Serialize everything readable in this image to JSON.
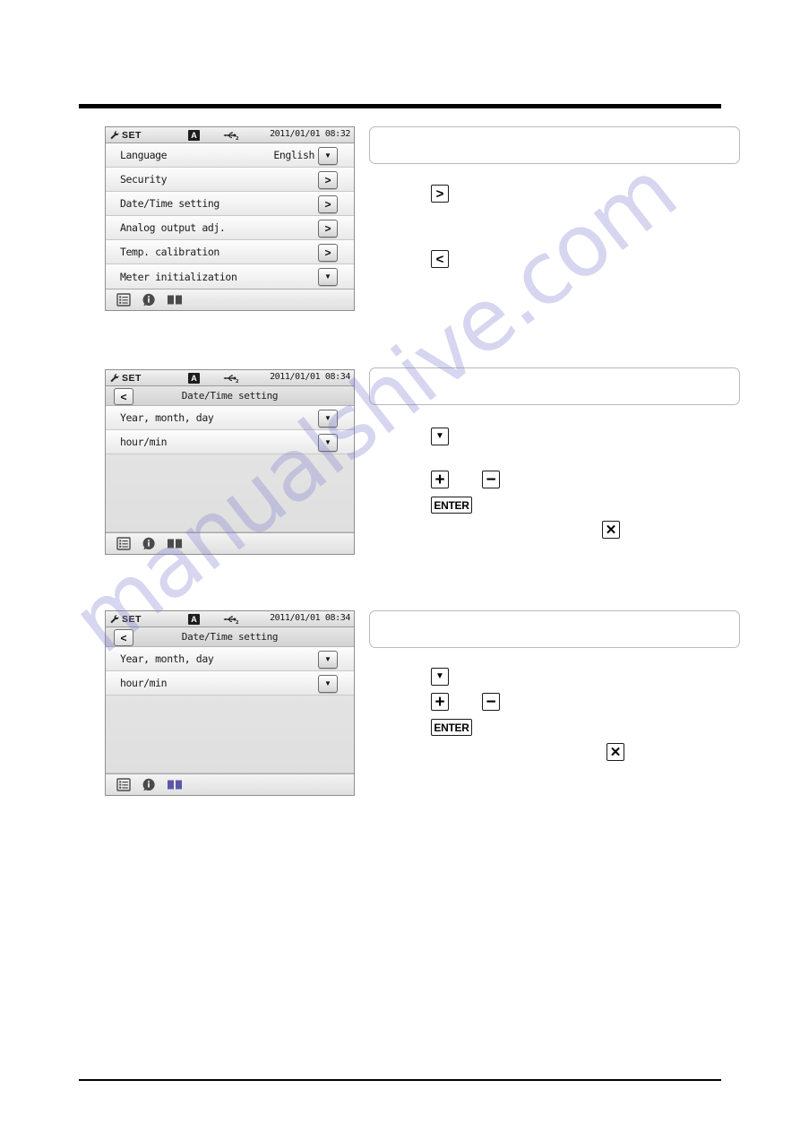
{
  "page": {
    "watermark_text": "manualshive.com",
    "watermark_color": "#7b7ad0"
  },
  "panels": [
    {
      "id": "settings-menu",
      "status": {
        "mode_label": "SET",
        "channel_badge": "A",
        "usb_label": "2",
        "datetime": "2011/01/01 08:32",
        "wrench_icon": "wrench-icon",
        "usb_icon": "usb-icon"
      },
      "rows": [
        {
          "label": "Language",
          "value": "English",
          "button": "▼",
          "button_kind": "dropdown"
        },
        {
          "label": "Security",
          "value": "",
          "button": "›",
          "button_kind": "enter"
        },
        {
          "label": "Date/Time setting",
          "value": "",
          "button": "›",
          "button_kind": "enter"
        },
        {
          "label": "Analog output adj.",
          "value": "",
          "button": "›",
          "button_kind": "enter"
        },
        {
          "label": "Temp. calibration",
          "value": "",
          "button": "›",
          "button_kind": "enter"
        },
        {
          "label": "Meter initialization",
          "value": "",
          "button": "▼",
          "button_kind": "dropdown"
        }
      ],
      "footer_icons": [
        "list-icon",
        "info-icon",
        "book-icon"
      ]
    },
    {
      "id": "datetime-setting-a",
      "status": {
        "mode_label": "SET",
        "channel_badge": "A",
        "usb_label": "2",
        "datetime": "2011/01/01 08:34",
        "wrench_icon": "wrench-icon",
        "usb_icon": "usb-icon"
      },
      "header": {
        "back_glyph": "‹",
        "title": "Date/Time setting"
      },
      "rows": [
        {
          "label": "Year, month, day",
          "value": "",
          "button": "▼",
          "button_kind": "dropdown"
        },
        {
          "label": "hour/min",
          "value": "",
          "button": "▼",
          "button_kind": "dropdown"
        }
      ],
      "footer_icons": [
        "list-icon",
        "info-icon",
        "book-icon"
      ]
    },
    {
      "id": "datetime-setting-b",
      "status": {
        "mode_label": "SET",
        "channel_badge": "A",
        "usb_label": "2",
        "datetime": "2011/01/01 08:34",
        "wrench_icon": "wrench-icon",
        "usb_icon": "usb-icon"
      },
      "header": {
        "back_glyph": "‹",
        "title": "Date/Time setting"
      },
      "rows": [
        {
          "label": "Year, month, day",
          "value": "",
          "button": "▼",
          "button_kind": "dropdown"
        },
        {
          "label": "hour/min",
          "value": "",
          "button": "▼",
          "button_kind": "dropdown"
        }
      ],
      "footer_icons": [
        "list-icon",
        "info-icon",
        "book-icon"
      ]
    }
  ],
  "instructions": [
    {
      "id": "step-1",
      "note": "",
      "keys": [
        {
          "name": "key-right-arrow",
          "glyph": "❯",
          "kind": "sq"
        },
        {
          "name": "key-left-arrow",
          "glyph": "❮",
          "kind": "sq"
        }
      ]
    },
    {
      "id": "step-2",
      "note": "",
      "keys": [
        {
          "name": "key-down-arrow",
          "glyph": "▼",
          "kind": "sq"
        },
        {
          "name": "key-plus",
          "glyph": "＋",
          "kind": "sq"
        },
        {
          "name": "key-minus",
          "glyph": "−",
          "kind": "sq"
        },
        {
          "name": "key-enter",
          "glyph": "ENTER",
          "kind": "enter"
        },
        {
          "name": "key-cancel",
          "glyph": "✕",
          "kind": "sq"
        }
      ]
    },
    {
      "id": "step-3",
      "note": "",
      "keys": [
        {
          "name": "key-down-arrow",
          "glyph": "▼",
          "kind": "sq"
        },
        {
          "name": "key-plus",
          "glyph": "＋",
          "kind": "sq"
        },
        {
          "name": "key-minus",
          "glyph": "−",
          "kind": "sq"
        },
        {
          "name": "key-enter",
          "glyph": "ENTER",
          "kind": "enter"
        },
        {
          "name": "key-cancel",
          "glyph": "✕",
          "kind": "sq"
        }
      ]
    }
  ]
}
